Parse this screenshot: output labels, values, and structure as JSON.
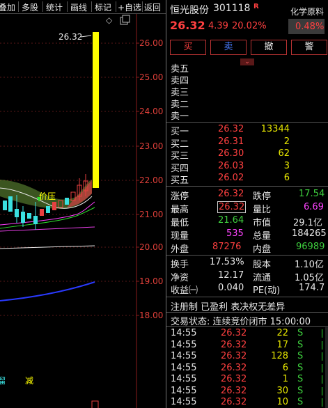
{
  "toolbar": {
    "items": [
      "叠加",
      "多股",
      "统计",
      "画线",
      "标记",
      "+自选",
      "返回"
    ]
  },
  "chart": {
    "y_ticks": [
      "26.00",
      "25.00",
      "24.00",
      "23.00",
      "22.00",
      "21.00",
      "20.00",
      "19.00",
      "18.00"
    ],
    "high_label": "26.32",
    "annotation": "价压",
    "bottom_marks": [
      "溜",
      "减"
    ],
    "diamond": "◇",
    "expand": "❐"
  },
  "header": {
    "name": "恒光股份",
    "code": "301118",
    "flag": "R",
    "sector": "化学原料",
    "price": "26.32",
    "change": "4.39",
    "pct": "20.02%",
    "sector_pct": "0.48%"
  },
  "actions": [
    "买",
    "卖",
    "撤",
    "警"
  ],
  "sell_levels": [
    "卖五",
    "卖四",
    "卖三",
    "卖二",
    "卖一"
  ],
  "buy_levels": [
    {
      "label": "买一",
      "price": "26.32",
      "vol": "13344"
    },
    {
      "label": "买二",
      "price": "26.31",
      "vol": "2"
    },
    {
      "label": "买三",
      "price": "26.30",
      "vol": "62"
    },
    {
      "label": "买四",
      "price": "26.03",
      "vol": "3"
    },
    {
      "label": "买五",
      "price": "26.02",
      "vol": "6"
    }
  ],
  "stats": {
    "limit_up_l": "涨停",
    "limit_up": "26.32",
    "limit_dn_l": "跌停",
    "limit_dn": "17.54",
    "high_l": "最高",
    "high": "26.32",
    "vol_ratio_l": "量比",
    "vol_ratio": "6.69",
    "low_l": "最低",
    "low": "21.64",
    "mcap_l": "市值",
    "mcap": "29.1亿",
    "cur_l": "现量",
    "cur": "535",
    "total_l": "总量",
    "total": "184265",
    "outer_l": "外盘",
    "outer": "87276",
    "inner_l": "内盘",
    "inner": "96989",
    "turn_l": "换手",
    "turn": "17.53%",
    "cap_l": "股本",
    "cap": "1.10亿",
    "nav_l": "净资",
    "nav": "12.17",
    "float_l": "流通",
    "float": "1.05亿",
    "eps_l": "收益㈠",
    "eps": "0.040",
    "pe_l": "PE(动)",
    "pe": "174.7"
  },
  "notice": "注册制 已盈利 表决权无差异",
  "status": "交易状态: 连续竞价闭市 15:00:00",
  "trades": [
    {
      "time": "14:55",
      "price": "26.32",
      "vol": "22",
      "side": "S"
    },
    {
      "time": "14:55",
      "price": "26.32",
      "vol": "17",
      "side": "S"
    },
    {
      "time": "14:55",
      "price": "26.32",
      "vol": "128",
      "side": "S"
    },
    {
      "time": "14:55",
      "price": "26.32",
      "vol": "6",
      "side": "S"
    },
    {
      "time": "14:55",
      "price": "26.32",
      "vol": "1",
      "side": "S"
    },
    {
      "time": "14:55",
      "price": "26.32",
      "vol": "30",
      "side": "S"
    },
    {
      "time": "14:55",
      "price": "26.32",
      "vol": "10",
      "side": "S"
    }
  ]
}
